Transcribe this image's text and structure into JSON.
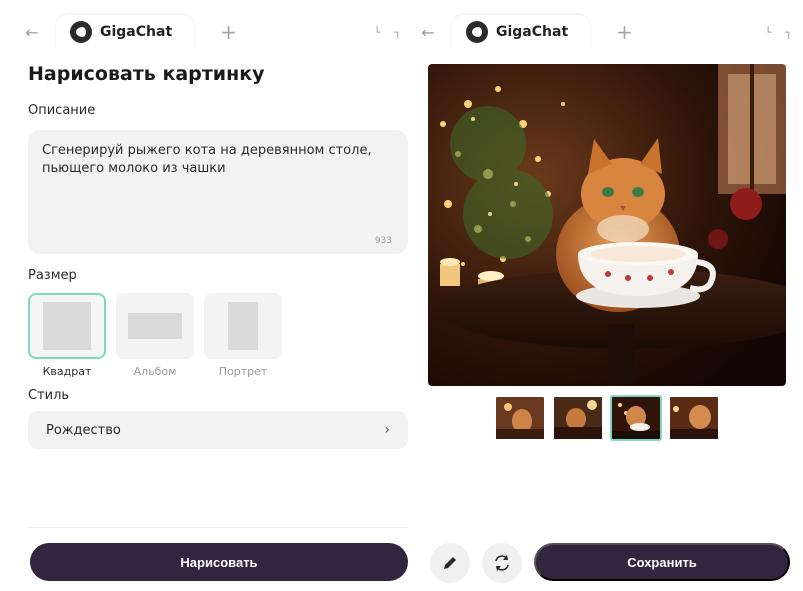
{
  "tabs_left": {
    "title": "GigaChat",
    "back_icon": "back-arrow-icon",
    "add_icon": "plus-icon"
  },
  "tabs_right": {
    "title": "GigaChat",
    "back_icon": "back-arrow-icon",
    "add_icon": "plus-icon"
  },
  "page_title": "Нарисовать картинку",
  "description": {
    "label": "Описание",
    "value": "Сгенерируй рыжего кота на деревянном столе, пьющего молоко из чашки",
    "char_count": "933"
  },
  "size": {
    "label": "Размер",
    "options": [
      {
        "label": "Квадрат",
        "selected": true
      },
      {
        "label": "Альбом",
        "selected": false
      },
      {
        "label": "Портрет",
        "selected": false
      }
    ]
  },
  "style": {
    "label": "Стиль",
    "value": "Рождество"
  },
  "buttons": {
    "draw": "Нарисовать",
    "save": "Сохранить"
  },
  "icons": {
    "edit": "pencil-icon",
    "regenerate": "refresh-icon",
    "chevron": "chevron-right-icon"
  },
  "colors": {
    "primary_button": "#34253f",
    "selection_accent": "#7fd8c2",
    "field_bg": "#f2f2f2"
  },
  "thumbnails": {
    "count": 4,
    "selected_index": 2
  }
}
